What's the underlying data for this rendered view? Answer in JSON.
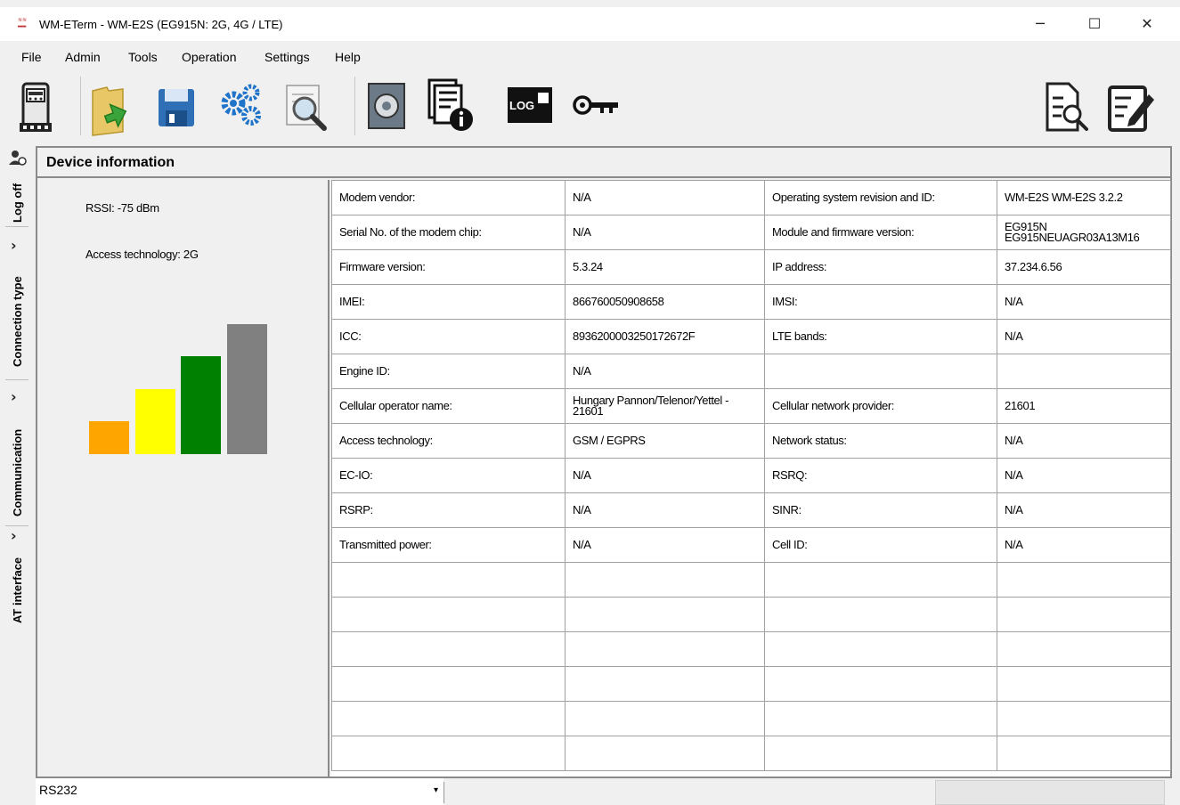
{
  "window": {
    "app_logo_text": "WM-ETerm",
    "title": "WM-ETerm - WM-E2S (EG915N: 2G, 4G / LTE)",
    "minimize_label": "─",
    "maximize_label": "☐",
    "close_label": "✕"
  },
  "menu": [
    "File",
    "Admin",
    "Tools",
    "Operation",
    "Settings",
    "Help"
  ],
  "toolbar": {
    "icons": [
      "meter-icon",
      "open-folder-icon",
      "save-icon",
      "settings-gears-icon",
      "inspect-document-icon",
      "firmware-disk-icon",
      "device-info-icon",
      "log-icon",
      "security-key-icon",
      "search-document-icon",
      "edit-document-icon"
    ],
    "log_text": "LOG"
  },
  "sidebar": {
    "tabs": [
      {
        "label": "Log off"
      },
      {
        "label": "Connection type"
      },
      {
        "label": "Communication"
      },
      {
        "label": "AT interface"
      }
    ],
    "chevron": "›"
  },
  "panel": {
    "title": "Device information",
    "rssi": "RSSI: -75 dBm",
    "access_technology": "Access technology: 2G",
    "signal_bars": [
      {
        "color": "#ffa500",
        "level": 0.25
      },
      {
        "color": "#ffff00",
        "level": 0.5
      },
      {
        "color": "#008000",
        "level": 0.75
      },
      {
        "color": "#808080",
        "level": 1.0
      }
    ]
  },
  "table": {
    "rows": [
      [
        "Modem vendor:",
        "N/A",
        "Operating system revision and ID:",
        "WM-E2S WM-E2S 3.2.2"
      ],
      [
        "Serial No. of the modem chip:",
        "N/A",
        "Module and firmware version:",
        "EG915N EG915NEUAGR03A13M16"
      ],
      [
        "Firmware version:",
        "5.3.24",
        "IP address:",
        "37.234.6.56"
      ],
      [
        "IMEI:",
        "866760050908658",
        "IMSI:",
        "N/A"
      ],
      [
        "ICC:",
        "8936200003250172672F",
        "LTE bands:",
        "N/A"
      ],
      [
        "Engine ID:",
        "N/A",
        "",
        ""
      ],
      [
        "Cellular operator name:",
        "Hungary Pannon/Telenor/Yettel - 21601",
        "Cellular network provider:",
        "21601"
      ],
      [
        "Access technology:",
        "GSM / EGPRS",
        "Network status:",
        "N/A"
      ],
      [
        "EC-IO:",
        "N/A",
        "RSRQ:",
        "N/A"
      ],
      [
        "RSRP:",
        "N/A",
        "SINR:",
        "N/A"
      ],
      [
        "Transmitted power:",
        "N/A",
        "Cell ID:",
        "N/A"
      ],
      [
        "",
        "",
        "",
        ""
      ],
      [
        "",
        "",
        "",
        ""
      ],
      [
        "",
        "",
        "",
        ""
      ],
      [
        "",
        "",
        "",
        ""
      ],
      [
        "",
        "",
        "",
        ""
      ],
      [
        "",
        "",
        "",
        ""
      ]
    ]
  },
  "statusbar": {
    "port": "RS232",
    "arrow": "▾"
  }
}
